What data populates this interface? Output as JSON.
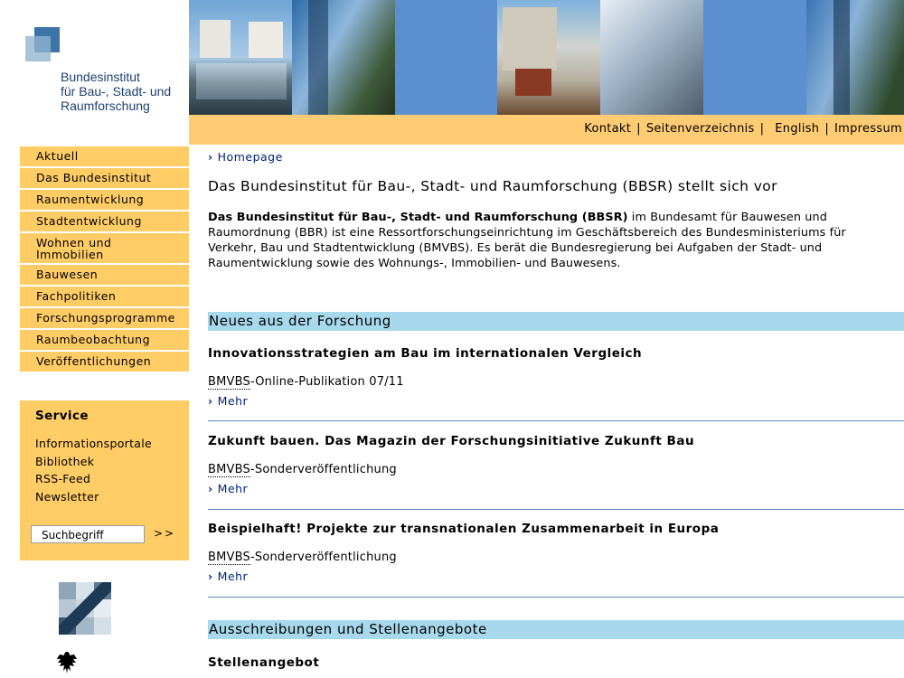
{
  "logo": {
    "line1": "Bundesinstitut",
    "line2": "für Bau-, Stadt- und",
    "line3": "Raumforschung"
  },
  "top_nav": [
    {
      "label": "Kontakt"
    },
    {
      "label": "Seitenverzeichnis"
    },
    {
      "label": "English"
    },
    {
      "label": "Impressum"
    }
  ],
  "left_nav": [
    {
      "label": "Aktuell"
    },
    {
      "label": "Das Bundesinstitut"
    },
    {
      "label": "Raumentwicklung"
    },
    {
      "label": "Stadtentwicklung"
    },
    {
      "label_line1": "Wohnen und",
      "label_line2": "Immobilien"
    },
    {
      "label": "Bauwesen"
    },
    {
      "label": "Fachpolitiken"
    },
    {
      "label": "Forschungsprogramme"
    },
    {
      "label": "Raumbeobachtung"
    },
    {
      "label": "Veröffentlichungen"
    }
  ],
  "service": {
    "title": "Service",
    "items": [
      {
        "label": "Informationsportale"
      },
      {
        "label": "Bibliothek"
      },
      {
        "label": "RSS-Feed"
      },
      {
        "label": "Newsletter"
      }
    ],
    "search_value": "Suchbegriff",
    "search_button": ">>"
  },
  "breadcrumb": {
    "chevron": "›",
    "label": "Homepage"
  },
  "page_title": "Das Bundesinstitut für Bau-, Stadt- und Raumforschung (BBSR) stellt sich vor",
  "intro": {
    "bold": "Das Bundesinstitut für Bau-, Stadt- und Raumforschung (BBSR)",
    "text": " im Bundesamt für Bauwesen und Raumordnung (BBR) ist eine Ressortforschungseinrichtung im Geschäftsbereich des Bundesministeriums für Verkehr, Bau und Stadtentwicklung (BMVBS). Es berät die Bundesregierung bei Aufgaben der Stadt- und Raumentwicklung sowie des Wohnungs-, Immobilien- und Bauwesens."
  },
  "section_research": {
    "title": "Neues aus der Forschung"
  },
  "news": [
    {
      "title": "Innovationsstrategien am Bau im internationalen Vergleich",
      "pub_abbr": "BMVBS",
      "pub_rest": "-Online-Publikation 07/11",
      "more": "Mehr"
    },
    {
      "title": "Zukunft bauen. Das Magazin der Forschungsinitiative Zukunft Bau",
      "pub_abbr": "BMVBS",
      "pub_rest": "-Sonderveröffentlichung",
      "more": "Mehr"
    },
    {
      "title": "Beispielhaft! Projekte zur transnationalen Zusammenarbeit in Europa",
      "pub_abbr": "BMVBS",
      "pub_rest": "-Sonderveröffentlichung",
      "more": "Mehr"
    }
  ],
  "section_jobs": {
    "title": "Ausschreibungen und Stellenangebote"
  },
  "jobs_first": {
    "title": "Stellenangebot"
  },
  "colors": {
    "nav_bg": "#ffcc66",
    "topnav_bg": "#ffcc73",
    "section_bar": "#a8d8ec",
    "link_blue": "#00237a",
    "logo_blue": "#1f3f6f"
  }
}
